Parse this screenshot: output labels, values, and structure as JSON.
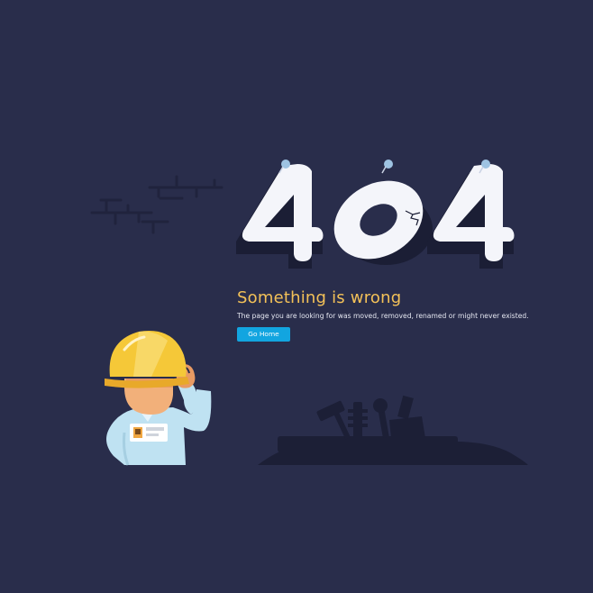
{
  "error": {
    "code_digits": [
      "4",
      "0",
      "4"
    ],
    "headline": "Something is wrong",
    "message": "The page you are looking for was moved, removed, renamed or might never existed.",
    "button_label": "Go Home"
  },
  "illustration": {
    "worker_badge_icon": "id-badge-icon",
    "helmet_icon": "hard-hat-icon",
    "tools_icon": "tools-silhouette-icon",
    "pin_icon": "push-pin-icon",
    "wall_icon": "brick-crack-icon"
  },
  "colors": {
    "background": "#292d4b",
    "headline": "#f3c158",
    "button": "#12a5e0",
    "digit_face": "#f4f5fa",
    "digit_shadow": "#1b1e35",
    "helmet": "#f5c838",
    "silhouette": "#1c1f36"
  }
}
